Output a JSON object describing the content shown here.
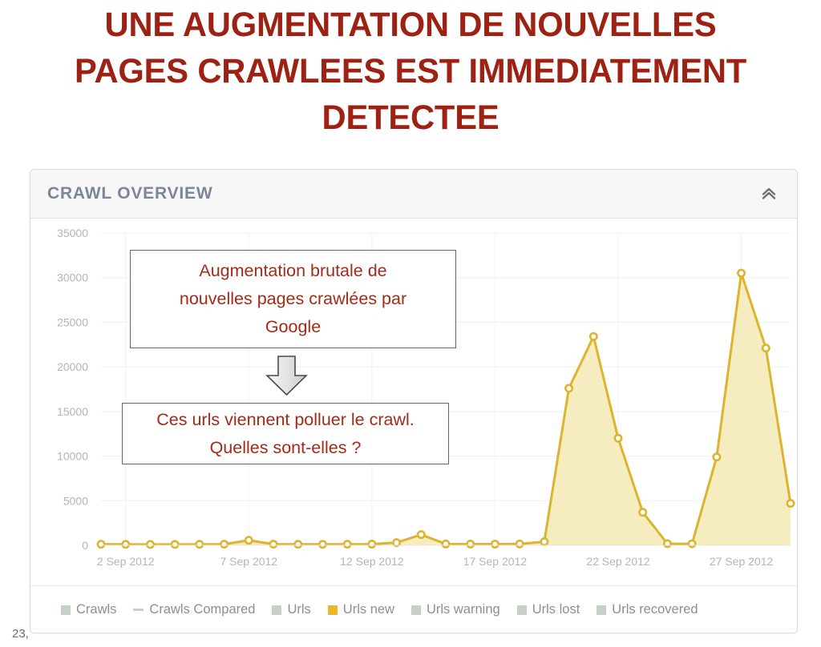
{
  "slide": {
    "title": "UNE AUGMENTATION DE NOUVELLES\nPAGES CRAWLEES EST IMMEDIATEMENT\nDETECTEE",
    "title_color": "#9d2213",
    "number": "23,"
  },
  "panel": {
    "title": "CRAWL OVERVIEW",
    "collapse_icon": "chevron-double-up-icon"
  },
  "callouts": [
    {
      "id": "callout-1",
      "text": "Augmentation brutale de\nnouvelles pages crawlées par\nGoogle",
      "color": "#a32b18"
    },
    {
      "id": "callout-2",
      "text": "Ces urls viennent polluer le crawl.\nQuelles sont-elles ?",
      "color": "#a32b18"
    }
  ],
  "arrow": {
    "name": "down-arrow-shape"
  },
  "legend": [
    {
      "label": "Crawls",
      "color": "#c7d0c6",
      "shape": "square",
      "active": false
    },
    {
      "label": "Crawls Compared",
      "color": "#c7d0c6",
      "shape": "dash",
      "active": false
    },
    {
      "label": "Urls",
      "color": "#c7d0c6",
      "shape": "square",
      "active": false
    },
    {
      "label": "Urls new",
      "color": "#e8b92b",
      "shape": "square",
      "active": true
    },
    {
      "label": "Urls warning",
      "color": "#c7d0c6",
      "shape": "square",
      "active": false
    },
    {
      "label": "Urls lost",
      "color": "#c7d0c6",
      "shape": "square",
      "active": false
    },
    {
      "label": "Urls recovered",
      "color": "#c7d0c6",
      "shape": "square",
      "active": false
    }
  ],
  "chart_data": {
    "type": "area",
    "title": "CRAWL OVERVIEW",
    "xlabel": "",
    "ylabel": "",
    "ylim": [
      0,
      35000
    ],
    "yticks": [
      0,
      5000,
      10000,
      15000,
      20000,
      25000,
      30000,
      35000
    ],
    "ytick_labels": [
      "0",
      "5000",
      "10000",
      "15000",
      "20000",
      "25000",
      "30000",
      "35000"
    ],
    "grid": true,
    "legend_position": "bottom",
    "line_color": "#ddb42e",
    "fill_color": "#f5ecc0",
    "marker_fill": "#ffffff",
    "x": [
      "1 Sep 2012",
      "2 Sep 2012",
      "3 Sep 2012",
      "4 Sep 2012",
      "5 Sep 2012",
      "6 Sep 2012",
      "7 Sep 2012",
      "8 Sep 2012",
      "9 Sep 2012",
      "10 Sep 2012",
      "11 Sep 2012",
      "12 Sep 2012",
      "13 Sep 2012",
      "14 Sep 2012",
      "15 Sep 2012",
      "16 Sep 2012",
      "17 Sep 2012",
      "18 Sep 2012",
      "19 Sep 2012",
      "20 Sep 2012",
      "21 Sep 2012",
      "22 Sep 2012",
      "23 Sep 2012",
      "24 Sep 2012",
      "25 Sep 2012",
      "26 Sep 2012",
      "27 Sep 2012",
      "28 Sep 2012",
      "29 Sep 2012"
    ],
    "xtick_labels": [
      "2 Sep 2012",
      "7 Sep 2012",
      "12 Sep 2012",
      "17 Sep 2012",
      "22 Sep 2012",
      "27 Sep 2012"
    ],
    "xtick_indices": [
      1,
      6,
      11,
      16,
      21,
      26
    ],
    "series": [
      {
        "name": "Urls new",
        "values": [
          120,
          110,
          100,
          100,
          110,
          120,
          560,
          120,
          110,
          110,
          120,
          130,
          300,
          1200,
          150,
          140,
          130,
          150,
          400,
          17600,
          23400,
          12000,
          3700,
          180,
          170,
          9900,
          30500,
          22100,
          4700
        ]
      }
    ]
  }
}
